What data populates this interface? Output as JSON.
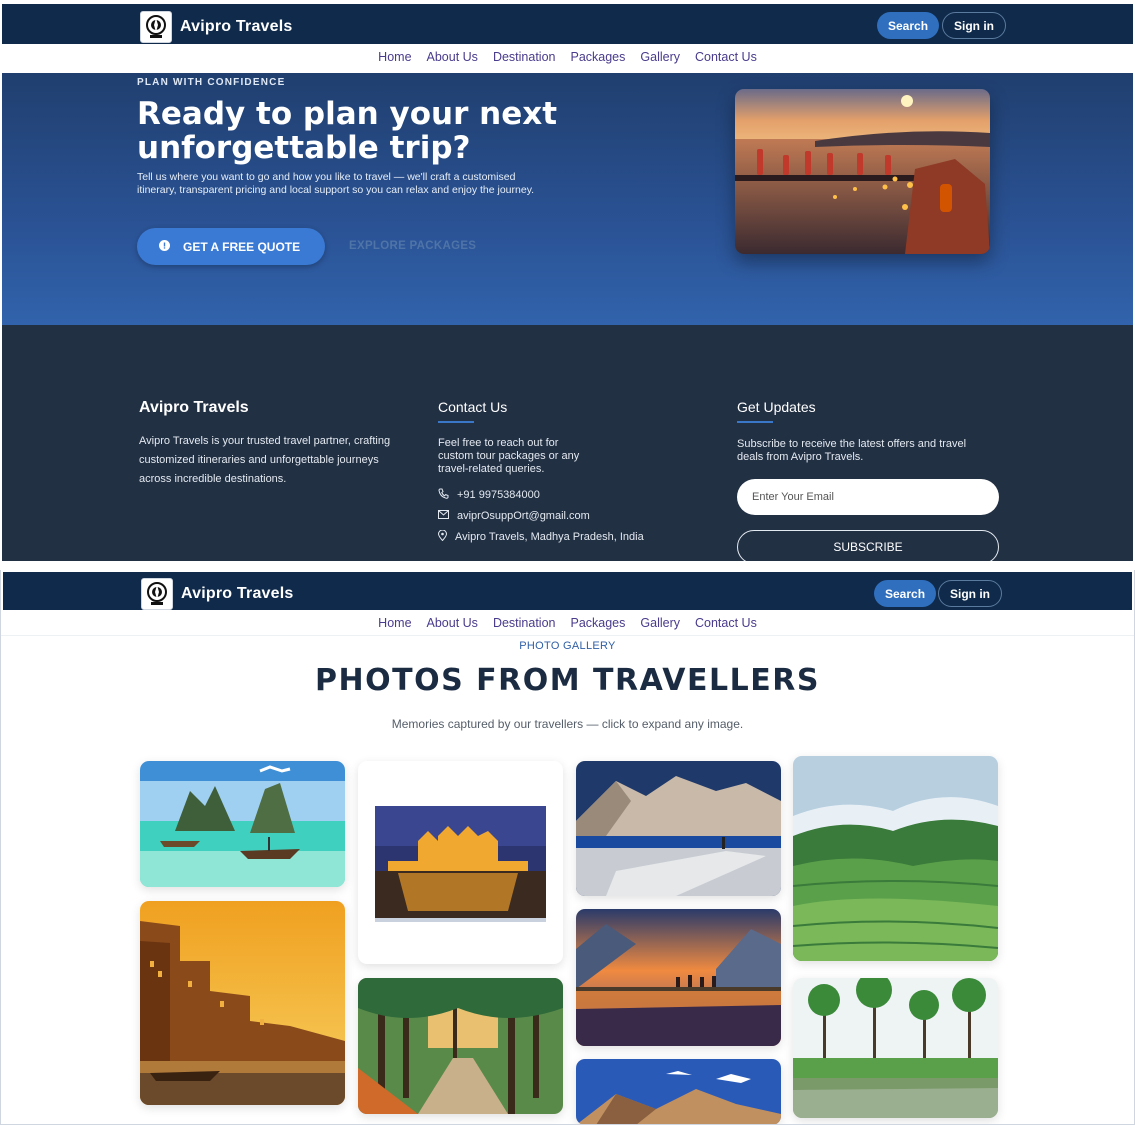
{
  "brand": {
    "name": "Avipro Travels",
    "logo_icon": "compass-globe-icon"
  },
  "header": {
    "search_label": "Search",
    "signin_label": "Sign in"
  },
  "nav": {
    "items": [
      "Home",
      "About Us",
      "Destination",
      "Packages",
      "Gallery",
      "Contact Us"
    ]
  },
  "hero": {
    "kicker": "PLAN WITH CONFIDENCE",
    "title": "Ready to plan your next unforgettable trip?",
    "description": "Tell us where you want to go and how you like to travel — we'll craft a customised itinerary, transparent pricing and local support so you can relax and enjoy the journey.",
    "quote_button": "GET A FREE QUOTE",
    "explore_button": "EXPLORE PACKAGES"
  },
  "footer": {
    "about": {
      "title": "Avipro Travels",
      "text": "Avipro Travels is your trusted travel partner, crafting customized itineraries and unforgettable journeys across incredible destinations."
    },
    "contact": {
      "title": "Contact Us",
      "intro": "Feel free to reach out for custom tour packages or any travel-related queries.",
      "phone": "+91 9975384000",
      "email": "aviprOsuppOrt@gmail.com",
      "address": "Avipro Travels, Madhya Pradesh, India"
    },
    "updates": {
      "title": "Get Updates",
      "text": "Subscribe to receive the latest offers and travel deals from Avipro Travels.",
      "email_placeholder": "Enter Your Email",
      "subscribe_label": "SUBSCRIBE"
    }
  },
  "gallery": {
    "kicker": "PHOTO GALLERY",
    "title": "PHOTOS FROM TRAVELLERS",
    "subtitle": "Memories captured by our travellers — click to expand any image."
  },
  "colors": {
    "header_bg": "#0f2a4a",
    "accent": "#2f6fbe",
    "footer_bg": "#223044",
    "hero_bg": "#2a5294"
  }
}
